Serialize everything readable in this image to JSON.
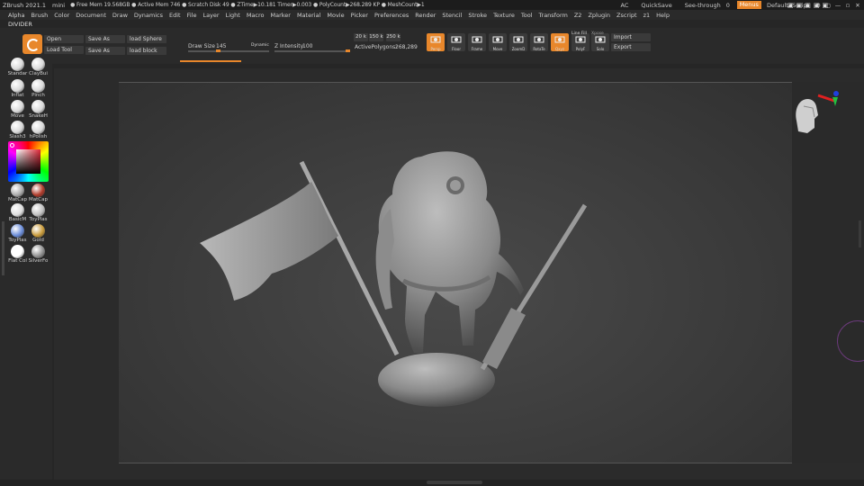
{
  "titlebar": {
    "app": "ZBrush 2021.1",
    "mode": "mini",
    "stats": "● Free Mem 19.568GB ● Active Mem 746 ● Scratch Disk 49 ● ZTime▶10.181 Timer▶0.003 ● PolyCount▶268.289 KP ● MeshCount▶1",
    "ac": "AC",
    "quicksave": "QuickSave",
    "see_through_label": "See-through",
    "see_through_value": "0",
    "menus": "Menus",
    "script": "DefaultZScript",
    "window_controls": [
      "⚙",
      "▢",
      "—",
      "▫",
      "✕"
    ]
  },
  "menubar": [
    "Alpha",
    "Brush",
    "Color",
    "Document",
    "Draw",
    "Dynamics",
    "Edit",
    "File",
    "Layer",
    "Light",
    "Macro",
    "Marker",
    "Material",
    "Movie",
    "Picker",
    "Preferences",
    "Render",
    "Stencil",
    "Stroke",
    "Texture",
    "Tool",
    "Transform",
    "Z2",
    "Zplugin",
    "Zscript",
    "z1",
    "Help"
  ],
  "divider_label": "DIVIDER",
  "shelf": {
    "open": "Open",
    "load_tool": "Load Tool",
    "save_as_1": "Save As",
    "save_as_2": "Save As",
    "load_sphere": "load Sphere",
    "load_block": "load block",
    "draw_size_label": "Draw Size",
    "draw_size_value": "145",
    "dynamic": "Dynamic",
    "z_intensity_label": "Z Intensity",
    "z_intensity_value": "100",
    "active_polygons_label": "ActivePolygons:",
    "active_polygons_value": "268,289",
    "poly_tags": [
      "20 k",
      "150 k",
      "250 k"
    ],
    "tool_buttons": [
      {
        "label": "Persp",
        "on": true
      },
      {
        "label": "Floor",
        "on": false
      },
      {
        "label": "Frame",
        "on": false
      },
      {
        "label": "Move",
        "on": false
      },
      {
        "label": "ZoomD",
        "on": false
      },
      {
        "label": "RotaTe",
        "on": false
      },
      {
        "label": "Qxyz",
        "on": true
      },
      {
        "label": "PolyF",
        "on": false
      },
      {
        "label": "Solo",
        "on": false
      }
    ],
    "line_fill": "Line Fill",
    "xpose": "Xpose",
    "import": "Import",
    "export": "Export"
  },
  "left_tools": [
    {
      "label": "Standar",
      "color": "#d9d9d9"
    },
    {
      "label": "ClayBui",
      "color": "#d9d9d9"
    },
    {
      "label": "Inflat",
      "color": "#d9d9d9"
    },
    {
      "label": "Pinch",
      "color": "#d9d9d9"
    },
    {
      "label": "Move",
      "color": "#d9d9d9"
    },
    {
      "label": "SnakeH",
      "color": "#d9d9d9"
    },
    {
      "label": "Slash3",
      "color": "#d9d9d9"
    },
    {
      "label": "hPolish",
      "color": "#d9d9d9"
    },
    {
      "label": "MatCap",
      "color": "#aaaaaa"
    },
    {
      "label": "MatCap",
      "color": "#b03a2a"
    },
    {
      "label": "BasicM",
      "color": "#dddddd"
    },
    {
      "label": "ToyPlas",
      "color": "#c0c0c0"
    },
    {
      "label": "ToyPlas",
      "color": "#6a8cd8"
    },
    {
      "label": "Gold",
      "color": "#c89a3a"
    },
    {
      "label": "Flat Col",
      "color": "#ffffff"
    },
    {
      "label": "SilverFo",
      "color": "#909090"
    }
  ]
}
